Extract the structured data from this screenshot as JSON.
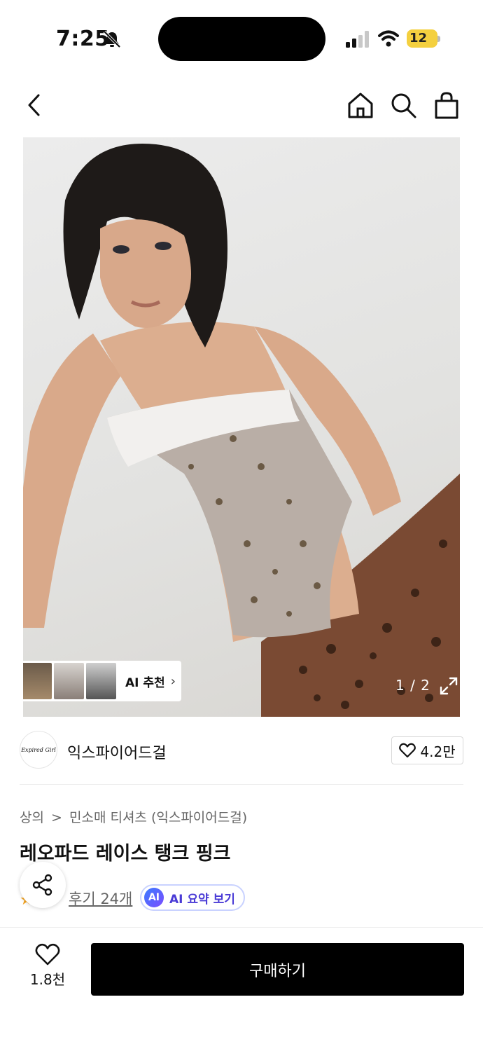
{
  "status_bar": {
    "time": "7:25",
    "battery": "12"
  },
  "nav": {
    "back_icon": "back-arrow-icon",
    "home_icon": "home-icon",
    "search_icon": "search-icon",
    "cart_icon": "shopping-bag-icon"
  },
  "image": {
    "ai_recommend_label": "AI 추천",
    "ai_recommend_chevron": "›",
    "counter": "1 / 2"
  },
  "brand": {
    "name": "익스파이어드걸",
    "logo_text": "Expired Girl",
    "likes": "4.2만"
  },
  "breadcrumb": {
    "category": "상의",
    "separator": ">",
    "subcategory": "민소매 티셔츠 (익스파이어드걸)"
  },
  "product": {
    "title": "레오파드 레이스 탱크 핑크"
  },
  "reviews": {
    "link": "후기 24개",
    "ai_badge": "AI",
    "ai_summary": "AI 요약 보기"
  },
  "bottom_bar": {
    "wish_count": "1.8천",
    "buy_label": "구매하기"
  },
  "colors": {
    "accent_black": "#000000",
    "ai_purple": "#4a3bd6",
    "battery_yellow": "#f4d03f"
  }
}
